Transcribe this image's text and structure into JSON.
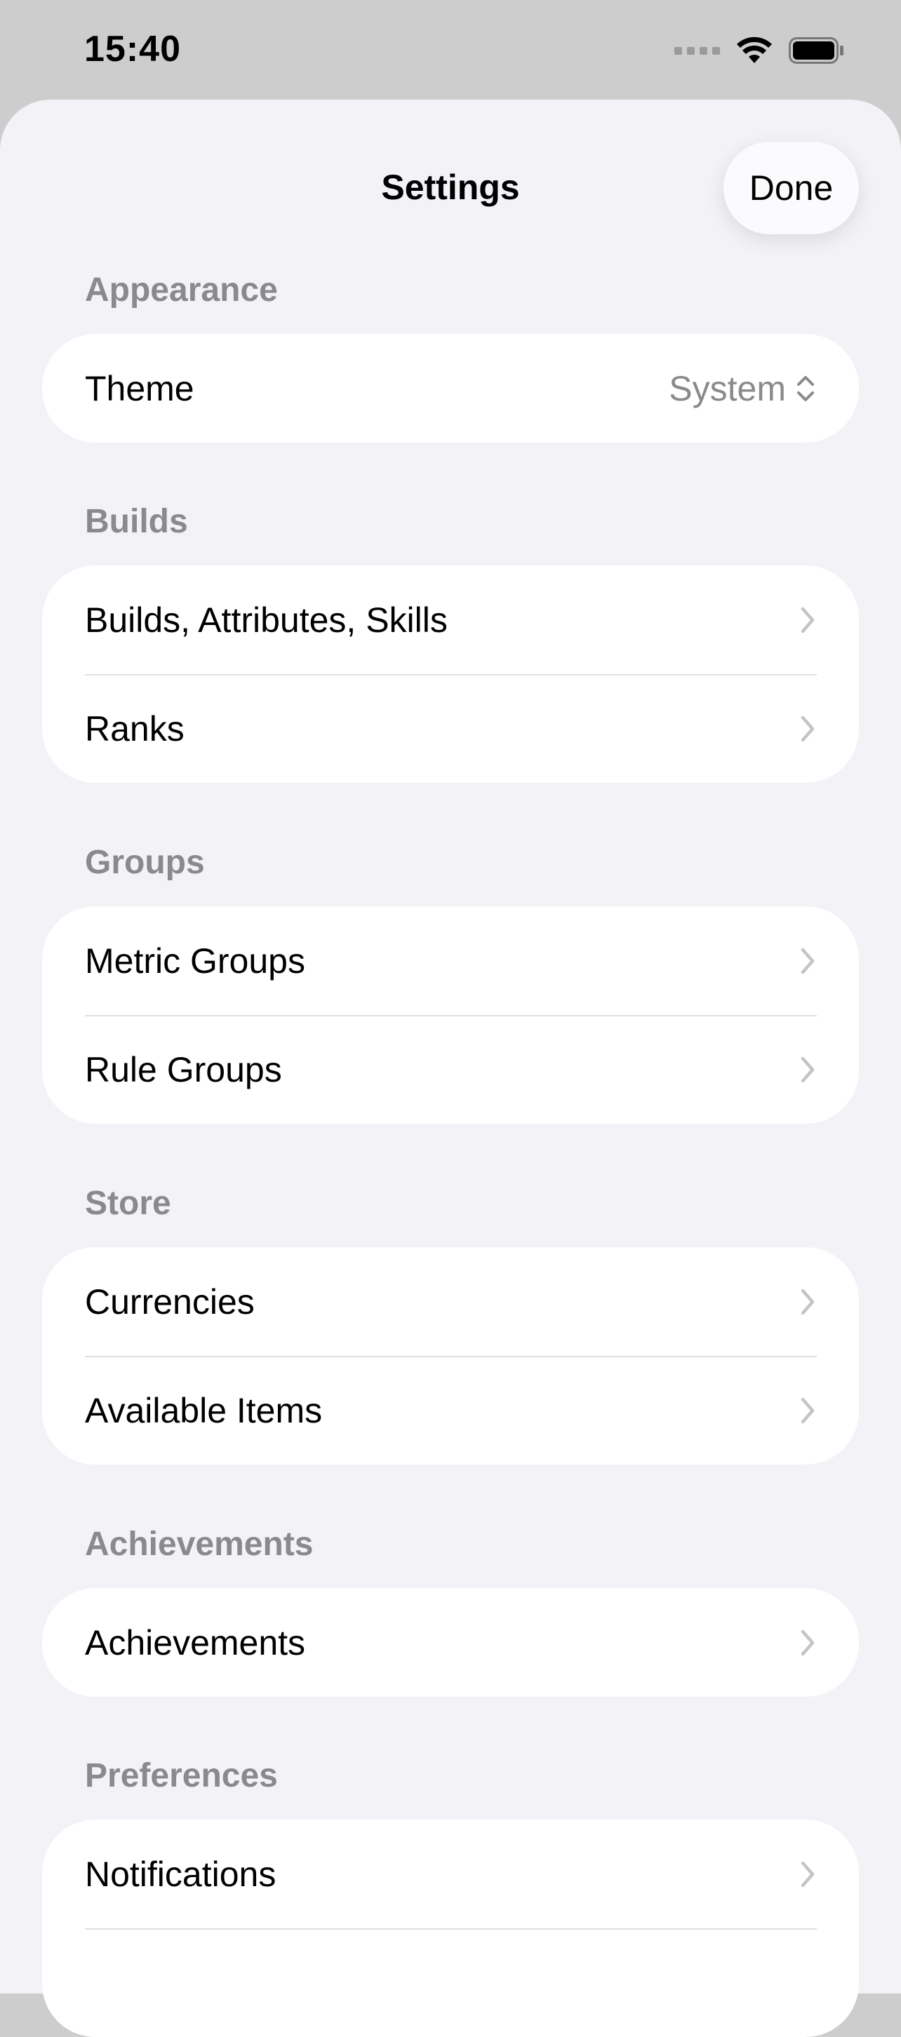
{
  "status_bar": {
    "time": "15:40"
  },
  "nav": {
    "title": "Settings",
    "done_label": "Done"
  },
  "sections": [
    {
      "header": "Appearance",
      "rows": [
        {
          "label": "Theme",
          "value": "System"
        }
      ]
    },
    {
      "header": "Builds",
      "rows": [
        {
          "label": "Builds, Attributes, Skills"
        },
        {
          "label": "Ranks"
        }
      ]
    },
    {
      "header": "Groups",
      "rows": [
        {
          "label": "Metric Groups"
        },
        {
          "label": "Rule Groups"
        }
      ]
    },
    {
      "header": "Store",
      "rows": [
        {
          "label": "Currencies"
        },
        {
          "label": "Available Items"
        }
      ]
    },
    {
      "header": "Achievements",
      "rows": [
        {
          "label": "Achievements"
        }
      ]
    },
    {
      "header": "Preferences",
      "rows": [
        {
          "label": "Notifications"
        },
        {
          "label": ""
        }
      ]
    }
  ],
  "colors": {
    "background": "#f2f2f7",
    "card": "#ffffff",
    "secondary_text": "#8a8a8e",
    "chevron": "#c4c4c7"
  }
}
